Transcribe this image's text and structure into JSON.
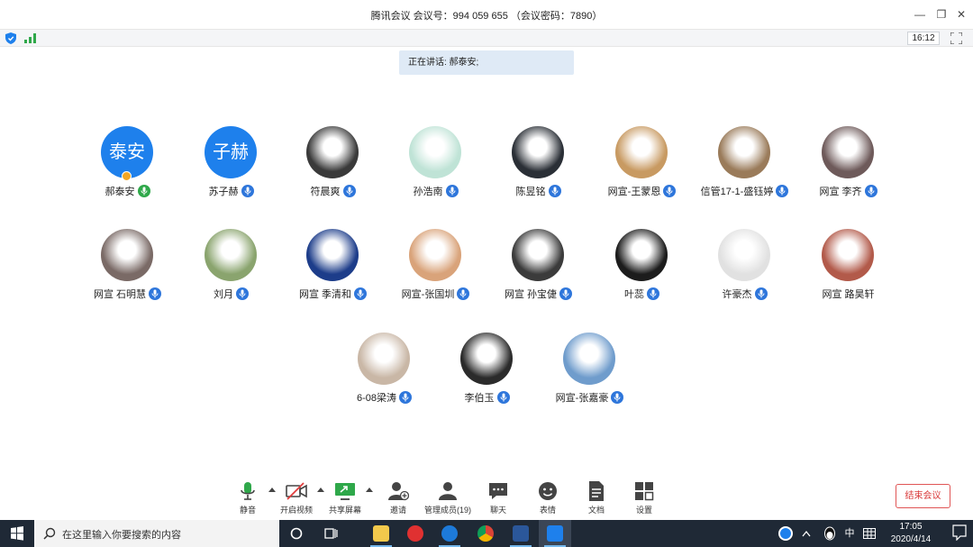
{
  "window": {
    "title": "腾讯会议 会议号：994 059 655 （会议密码：7890）"
  },
  "status": {
    "clock": "16:12"
  },
  "speaking": {
    "text": "正在讲话: 郝泰安;"
  },
  "participants": [
    {
      "name": "郝泰安",
      "initials": "泰安",
      "mic": "green",
      "avatar_color": "#1e80ec"
    },
    {
      "name": "苏子赫",
      "initials": "子赫",
      "mic": "blue",
      "avatar_color": "#1e80ec"
    },
    {
      "name": "符晨爽",
      "mic": "blue",
      "avatar_color": "#3a3a3a"
    },
    {
      "name": "孙浩南",
      "mic": "blue",
      "avatar_color": "#bfe3d6"
    },
    {
      "name": "陈昱铭",
      "mic": "blue",
      "avatar_color": "#2a2f36"
    },
    {
      "name": "网宣-王蒙恩",
      "mic": "blue",
      "avatar_color": "#c89a62"
    },
    {
      "name": "信管17-1-盛钰婷",
      "mic": "blue",
      "avatar_color": "#9a7b5a"
    },
    {
      "name": "网宣 李齐",
      "mic": "blue",
      "avatar_color": "#6e5a5a"
    },
    {
      "name": "网宣 石明慧",
      "mic": "blue",
      "avatar_color": "#7a6a66"
    },
    {
      "name": "刘月",
      "mic": "blue",
      "avatar_color": "#8aa46e"
    },
    {
      "name": "网宣  季清和",
      "mic": "blue",
      "avatar_color": "#1d3d8a"
    },
    {
      "name": "网宣-张国圳",
      "mic": "blue",
      "avatar_color": "#d9a37a"
    },
    {
      "name": "网宣  孙宝倢",
      "mic": "blue",
      "avatar_color": "#3b3b3b"
    },
    {
      "name": "叶蕊",
      "mic": "blue",
      "avatar_color": "#1c1c1c"
    },
    {
      "name": "许豪杰",
      "mic": "blue",
      "avatar_color": "#e1e1e1"
    },
    {
      "name": "网宣 路昊轩",
      "mic": "none",
      "avatar_color": "#b25a4a"
    },
    {
      "name": "6-08梁涛",
      "mic": "blue",
      "avatar_color": "#c9b7a6"
    },
    {
      "name": "李伯玉",
      "mic": "blue",
      "avatar_color": "#2b2b2b"
    },
    {
      "name": "网宣-张嘉豪",
      "mic": "blue",
      "avatar_color": "#6f9ccc"
    }
  ],
  "toolbar": {
    "mute_label": "静音",
    "video_label": "开启视频",
    "share_label": "共享屏幕",
    "invite_label": "邀请",
    "members_label": "管理成员(19)",
    "chat_label": "聊天",
    "emoji_label": "表情",
    "docs_label": "文档",
    "settings_label": "设置",
    "end_label": "结束会议"
  },
  "taskbar": {
    "search_placeholder": "在这里输入你要搜索的内容",
    "ime_label": "中",
    "time": "17:05",
    "date": "2020/4/14"
  },
  "colors": {
    "accent": "#1e80ec",
    "mic_blue": "#2e76db",
    "mic_green": "#2fa84a",
    "end_red": "#d93a3a",
    "taskbar": "#1f2936"
  }
}
